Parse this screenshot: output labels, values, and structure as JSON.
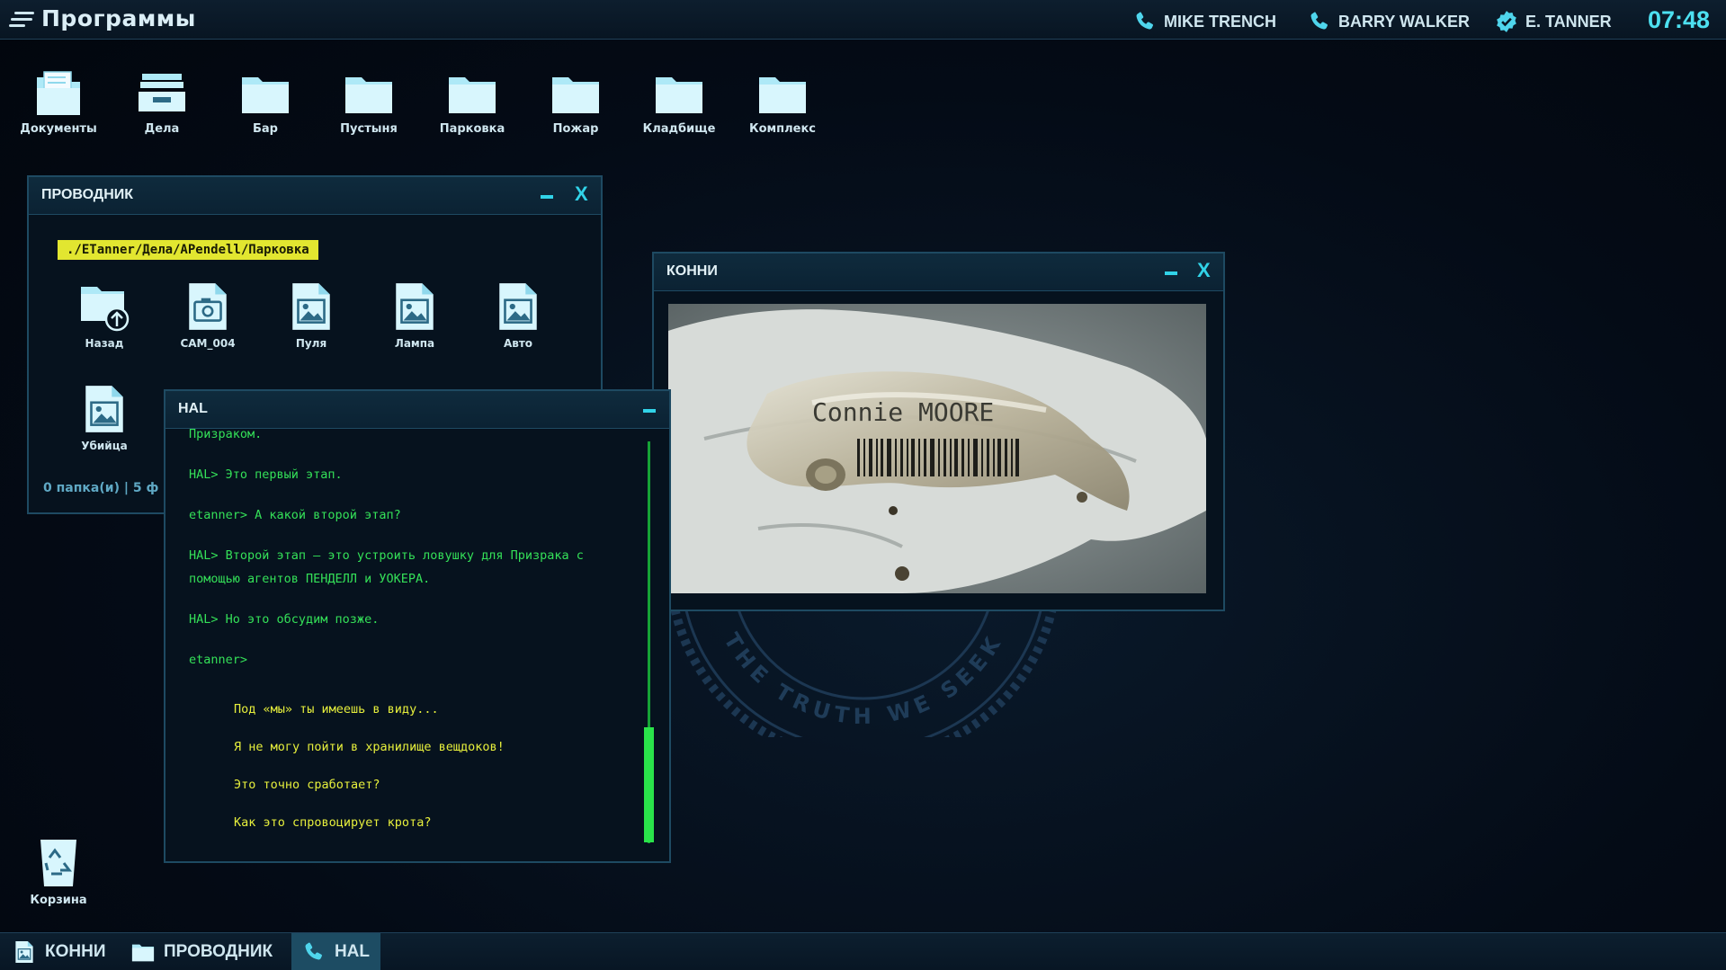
{
  "topbar": {
    "title": "Программы",
    "contacts": [
      {
        "name": "MIKE TRENCH",
        "icon": "phone-icon"
      },
      {
        "name": "BARRY WALKER",
        "icon": "phone-icon"
      },
      {
        "name": "E. TANNER",
        "icon": "badge-check-icon"
      }
    ],
    "clock": "07:48"
  },
  "desktop": {
    "icons": [
      {
        "label": "Документы",
        "icon": "documents-folder-icon"
      },
      {
        "label": "Дела",
        "icon": "cases-tray-icon"
      },
      {
        "label": "Бар",
        "icon": "folder-icon"
      },
      {
        "label": "Пустыня",
        "icon": "folder-icon"
      },
      {
        "label": "Парковка",
        "icon": "folder-icon"
      },
      {
        "label": "Пожар",
        "icon": "folder-icon"
      },
      {
        "label": "Кладбище",
        "icon": "folder-icon"
      },
      {
        "label": "Комплекс",
        "icon": "folder-icon"
      }
    ],
    "trash_label": "Корзина"
  },
  "explorer": {
    "title": "ПРОВОДНИК",
    "close_label": "X",
    "path": "./ETanner/Дела/APendell/Парковка",
    "files": [
      {
        "label": "Назад",
        "icon": "folder-up-icon"
      },
      {
        "label": "CAM_004",
        "icon": "camera-file-icon"
      },
      {
        "label": "Пуля",
        "icon": "image-file-icon"
      },
      {
        "label": "Лампа",
        "icon": "image-file-icon"
      },
      {
        "label": "Авто",
        "icon": "image-file-icon"
      },
      {
        "label": "Убийца",
        "icon": "image-file-icon"
      }
    ],
    "status": "0 папка(и)  |  5 ф"
  },
  "hal": {
    "title": "HAL",
    "lines": [
      "Призраком.",
      "HAL> Это первый этап.",
      "etanner> А какой второй этап?",
      "HAL> Второй этап — это устроить ловушку для Призрака с",
      "помощью агентов ПЕНДЕЛЛ и УОКЕРА.",
      "HAL> Но это обсудим позже.",
      "etanner>"
    ],
    "choices": [
      "Под «мы» ты имеешь в виду...",
      "Я не могу пойти в хранилище вещдоков!",
      "Это точно сработает?",
      "Как это спровоцирует крота?"
    ]
  },
  "connie": {
    "title": "КОННИ",
    "close_label": "X",
    "photo_text": "Connie MOORE"
  },
  "emblem": {
    "motto": "THE TRUTH WE SEEK"
  },
  "taskbar": {
    "items": [
      {
        "label": "КОННИ",
        "icon": "image-icon"
      },
      {
        "label": "ПРОВОДНИК",
        "icon": "folder-icon"
      },
      {
        "label": "HAL",
        "icon": "phone-icon"
      }
    ]
  },
  "colors": {
    "accent": "#31d3e8",
    "terminal_green": "#34e058",
    "choice_yellow": "#e6ef3c",
    "path_yellow": "#e2e630"
  }
}
